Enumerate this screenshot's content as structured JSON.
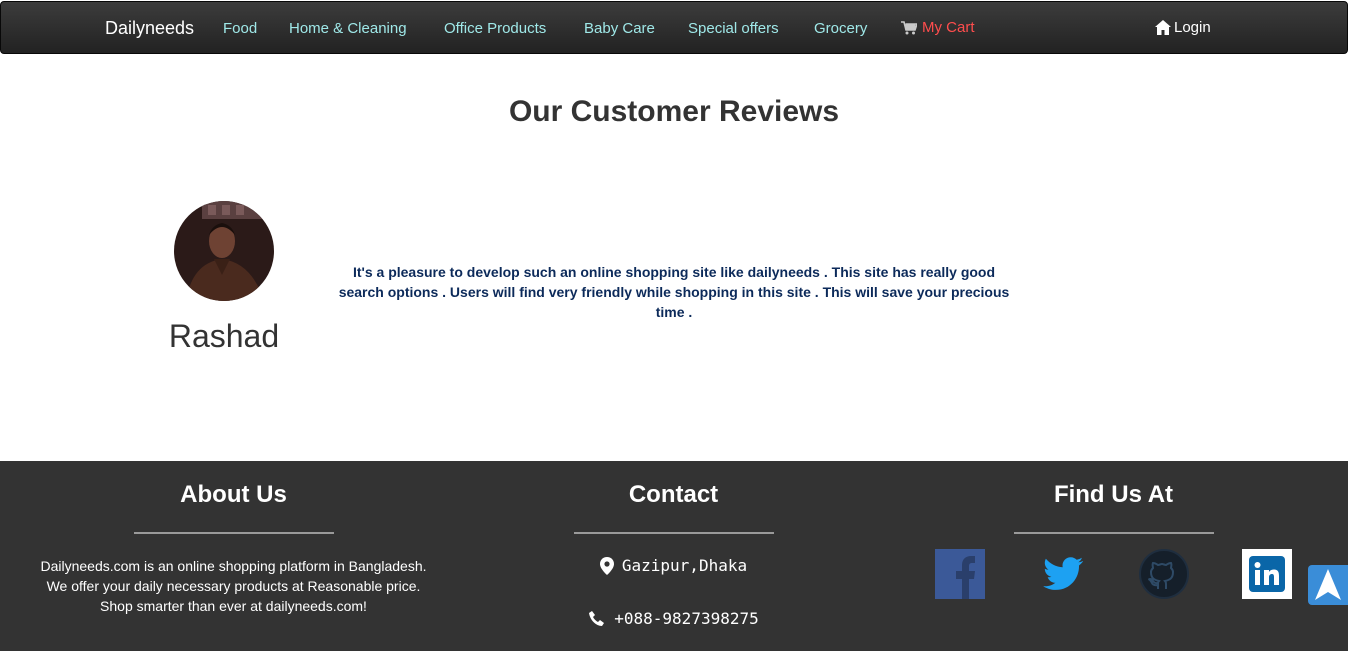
{
  "navbar": {
    "brand": "Dailyneeds",
    "links": [
      {
        "label": "Food"
      },
      {
        "label": "Home & Cleaning"
      },
      {
        "label": "Office Products"
      },
      {
        "label": "Baby Care"
      },
      {
        "label": "Special offers"
      },
      {
        "label": "Grocery"
      }
    ],
    "cart_label": "My Cart",
    "login_label": "Login",
    "cart_icon": "cart-icon",
    "login_icon": "home-icon"
  },
  "reviews": {
    "title": "Our Customer Reviews",
    "items": [
      {
        "name": "Rashad",
        "text": "It's a pleasure to develop such an online shopping site like dailyneeds . This site has really good search options . Users will find very friendly while shopping in this site . This will save your precious time ."
      }
    ]
  },
  "footer": {
    "about": {
      "title": "About Us",
      "lines": [
        "Dailyneeds.com is an online shopping platform in Bangladesh.",
        "We offer your daily necessary products at Reasonable price.",
        "Shop smarter than ever at dailyneeds.com!"
      ]
    },
    "contact": {
      "title": "Contact",
      "address": "Gazipur,Dhaka",
      "phone": "+088-9827398275"
    },
    "find_us": {
      "title": "Find Us At",
      "links": [
        "facebook-icon",
        "twitter-icon",
        "github-icon",
        "linkedin-icon"
      ]
    }
  },
  "colors": {
    "nav_link": "#9fe8e8",
    "cart": "#ff4d4d",
    "review_text": "#0c2a5a",
    "footer_bg": "#333333",
    "back_to_top": "#3a8dd8"
  }
}
